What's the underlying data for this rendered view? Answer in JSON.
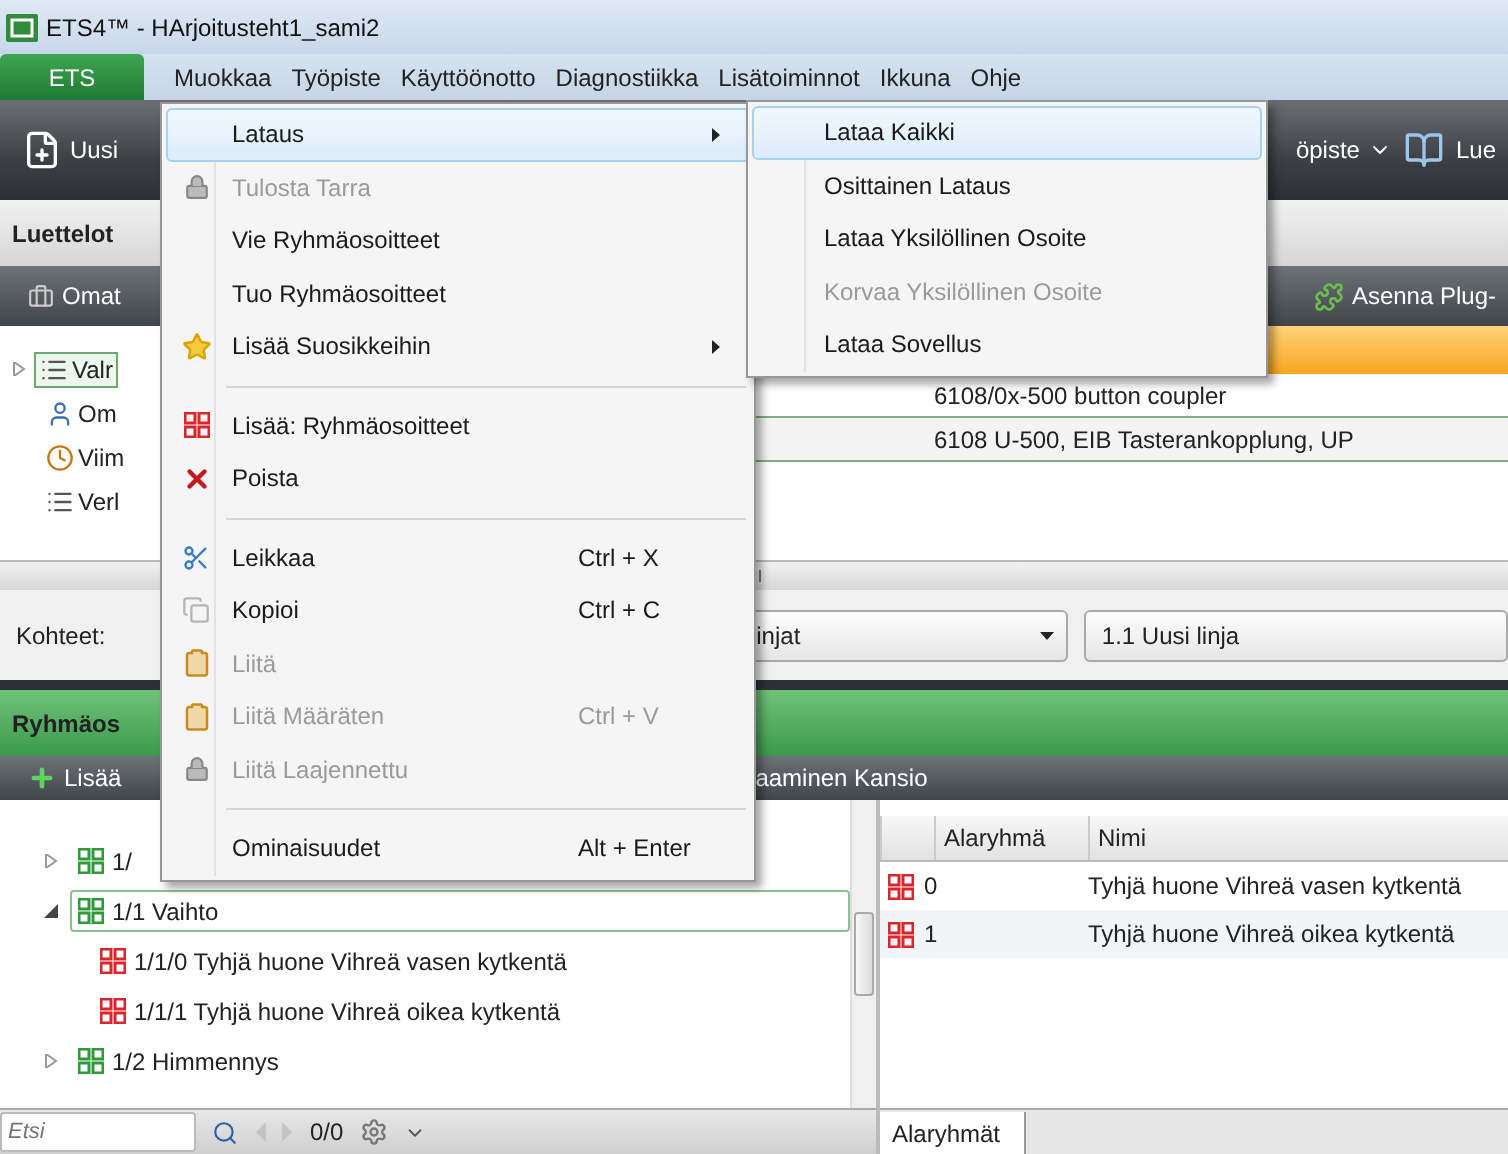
{
  "window": {
    "title": "ETS4™ - HArjoitusteht1_sami2"
  },
  "menu_bar": [
    {
      "label": "ETS",
      "kind": "app"
    },
    {
      "label": "Muokkaa",
      "kind": "menu"
    },
    {
      "label": "Työpiste",
      "kind": "menu"
    },
    {
      "label": "Käyttöönotto",
      "kind": "menu"
    },
    {
      "label": "Diagnostiikka",
      "kind": "menu"
    },
    {
      "label": "Lisätoiminnot",
      "kind": "menu"
    },
    {
      "label": "Ikkuna",
      "kind": "menu"
    },
    {
      "label": "Ohje",
      "kind": "menu"
    }
  ],
  "toolbar": {
    "new_button": "Uusi",
    "workspace_button": "öpiste",
    "catalog_button": "Lue"
  },
  "catalogs_panel": {
    "title": "Luettelot",
    "toolbar_button": "Omat",
    "plugin_button": "Asenna Plug-",
    "tree": [
      {
        "label": "Valr",
        "selected": true,
        "expanded": false
      },
      {
        "label": "Om",
        "selected": false
      },
      {
        "label": "Viim",
        "selected": false
      },
      {
        "label": "Verl",
        "selected": false
      }
    ],
    "rows": [
      "6108/0x-500 button coupler",
      "6108 U-500, EIB Tasterankopplung, UP"
    ]
  },
  "filter": {
    "label": "Kohteet:",
    "dropdowns": [
      "injat",
      "1.1 Uusi linja"
    ]
  },
  "group_panel": {
    "title": "Ryhmäos",
    "add_button": "Lisää",
    "folder_button": "aaminen Kansio",
    "tree": [
      {
        "label": "1/",
        "kind": "group",
        "expanded": false,
        "selected": false
      },
      {
        "label": "1/1 Vaihto",
        "kind": "group",
        "expanded": true,
        "selected": true,
        "children": [
          {
            "label": "1/1/0 Tyhjä huone Vihreä vasen kytkentä",
            "kind": "address",
            "selected": false
          },
          {
            "label": "1/1/1 Tyhjä huone Vihreä oikea kytkentä",
            "kind": "address",
            "selected": false
          }
        ]
      },
      {
        "label": "1/2 Himmennys",
        "kind": "group",
        "expanded": false,
        "selected": false
      }
    ],
    "search": {
      "placeholder": "Etsi",
      "count": "0/0"
    },
    "table": {
      "columns": [
        "Alaryhmä",
        "Nimi"
      ],
      "rows": [
        {
          "subgroup": "0",
          "name": "Tyhjä huone Vihreä vasen kytkentä"
        },
        {
          "subgroup": "1",
          "name": "Tyhjä huone Vihreä oikea kytkentä"
        }
      ]
    },
    "tabs": [
      {
        "label": "Alaryhmät",
        "selected": true
      }
    ]
  },
  "edit_menu": {
    "items": [
      {
        "kind": "item",
        "label": "Lataus",
        "highlighted": true,
        "disabled": false,
        "submenu": true
      },
      {
        "kind": "item",
        "label": "Tulosta Tarra",
        "highlighted": false,
        "disabled": true,
        "submenu": false
      },
      {
        "kind": "item",
        "label": "Vie Ryhmäosoitteet",
        "highlighted": false,
        "disabled": false,
        "submenu": false
      },
      {
        "kind": "item",
        "label": "Tuo Ryhmäosoitteet",
        "highlighted": false,
        "disabled": false,
        "submenu": false
      },
      {
        "kind": "item",
        "label": "Lisää Suosikkeihin",
        "highlighted": false,
        "disabled": false,
        "submenu": true
      },
      {
        "kind": "separator"
      },
      {
        "kind": "item",
        "label": "Lisää: Ryhmäosoitteet",
        "highlighted": false,
        "disabled": false,
        "submenu": false
      },
      {
        "kind": "item",
        "label": "Poista",
        "highlighted": false,
        "disabled": false,
        "submenu": false
      },
      {
        "kind": "separator"
      },
      {
        "kind": "item",
        "label": "Leikkaa",
        "shortcut": "Ctrl + X",
        "highlighted": false,
        "disabled": false,
        "submenu": false
      },
      {
        "kind": "item",
        "label": "Kopioi",
        "shortcut": "Ctrl + C",
        "highlighted": false,
        "disabled": false,
        "submenu": false
      },
      {
        "kind": "item",
        "label": "Liitä",
        "highlighted": false,
        "disabled": true,
        "submenu": false
      },
      {
        "kind": "item",
        "label": "Liitä Määräten",
        "shortcut": "Ctrl + V",
        "highlighted": false,
        "disabled": true,
        "submenu": false
      },
      {
        "kind": "item",
        "label": "Liitä Laajennettu",
        "highlighted": false,
        "disabled": true,
        "submenu": false
      },
      {
        "kind": "separator"
      },
      {
        "kind": "item",
        "label": "Ominaisuudet",
        "shortcut": "Alt + Enter",
        "highlighted": false,
        "disabled": false,
        "submenu": false
      }
    ]
  },
  "download_submenu": {
    "items": [
      {
        "label": "Lataa Kaikki",
        "highlighted": true,
        "disabled": false
      },
      {
        "label": "Osittainen Lataus",
        "highlighted": false,
        "disabled": false
      },
      {
        "label": "Lataa Yksilöllinen Osoite",
        "highlighted": false,
        "disabled": false
      },
      {
        "label": "Korvaa Yksilöllinen Osoite",
        "highlighted": false,
        "disabled": true
      },
      {
        "label": "Lataa Sovellus",
        "highlighted": false,
        "disabled": false
      }
    ]
  }
}
